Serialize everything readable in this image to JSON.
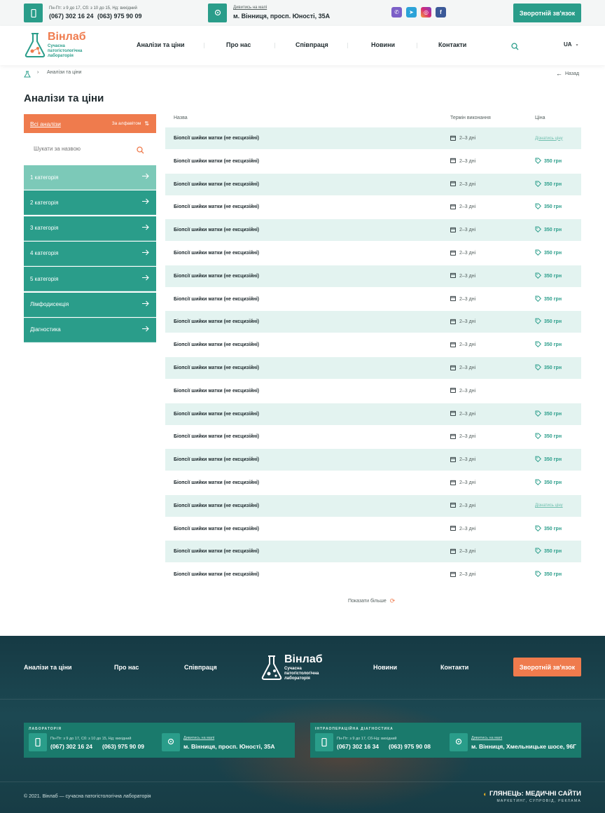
{
  "topbar": {
    "hours": "Пн-Пт: з 9 до 17, Сб: з 10 до 15, Нд: вихідний",
    "phone1": "(067) 302 16 24",
    "phone2": "(063) 975 90 09",
    "map_link": "Дивитись на мапі",
    "address": "м. Вінниця, просп. Юності, 35А",
    "callback_button": "Зворотній зв'язок",
    "social": [
      "viber",
      "telegram",
      "instagram",
      "facebook"
    ]
  },
  "header": {
    "logo_title": "Вінлаб",
    "logo_subtitle": "Сучасна патогістологічна лабораторія",
    "nav": [
      "Аналізи та ціни",
      "Про нас",
      "Співпраця",
      "Новини",
      "Контакти"
    ],
    "lang": "UA"
  },
  "breadcrumbs": {
    "current": "Аналізи та ціни",
    "back": "Назад"
  },
  "page_title": "Аналізи та ціни",
  "sidebar": {
    "all_label": "Всі аналізи",
    "sort_label": "За алфавітом",
    "search_placeholder": "Шукати за назвою",
    "categories": [
      "1 категорія",
      "2 категорія",
      "3 категорія",
      "4 категорія",
      "5 категорія",
      "Лімфодисекція",
      "Діагностика"
    ]
  },
  "table": {
    "headers": {
      "name": "Назва",
      "term": "Термін виконання",
      "price": "Ціна"
    },
    "rows": [
      {
        "name": "Біопсії шийки матки (не ексцизійні)",
        "term": "2–3 дні",
        "price": "Дізнатись ціну",
        "type": "link"
      },
      {
        "name": "Біопсії шийки матки (не ексцизійні)",
        "term": "2–3 дні",
        "price": "350 грн",
        "type": "price"
      },
      {
        "name": "Біопсії шийки матки (не ексцизійні)",
        "term": "2–3 дні",
        "price": "350 грн",
        "type": "price"
      },
      {
        "name": "Біопсії шийки матки (не ексцизійні)",
        "term": "2–3 дні",
        "price": "350 грн",
        "type": "price"
      },
      {
        "name": "Біопсії шийки матки (не ексцизійні)",
        "term": "2–3 дні",
        "price": "350 грн",
        "type": "price"
      },
      {
        "name": "Біопсії шийки матки (не ексцизійні)",
        "term": "2–3 дні",
        "price": "350 грн",
        "type": "price"
      },
      {
        "name": "Біопсії шийки матки (не ексцизійні)",
        "term": "2–3 дні",
        "price": "350 грн",
        "type": "price"
      },
      {
        "name": "Біопсії шийки матки (не ексцизійні)",
        "term": "2–3 дні",
        "price": "350 грн",
        "type": "price"
      },
      {
        "name": "Біопсії шийки матки (не ексцизійні)",
        "term": "2–3 дні",
        "price": "350 грн",
        "type": "price"
      },
      {
        "name": "Біопсії шийки матки (не ексцизійні)",
        "term": "2–3 дні",
        "price": "350 грн",
        "type": "price"
      },
      {
        "name": "Біопсії шийки матки (не ексцизійні)",
        "term": "2–3 дні",
        "price": "350 грн",
        "type": "price"
      },
      {
        "name": "Біопсії шийки матки (не ексцизійні)",
        "term": "2–3 дні",
        "price": "",
        "type": "none"
      },
      {
        "name": "Біопсії шийки матки (не ексцизійні)",
        "term": "2–3 дні",
        "price": "350 грн",
        "type": "price"
      },
      {
        "name": "Біопсії шийки матки (не ексцизійні)",
        "term": "2–3 дні",
        "price": "350 грн",
        "type": "price"
      },
      {
        "name": "Біопсії шийки матки (не ексцизійні)",
        "term": "2–3 дні",
        "price": "350 грн",
        "type": "price"
      },
      {
        "name": "Біопсії шийки матки (не ексцизійні)",
        "term": "2–3 дні",
        "price": "350 грн",
        "type": "price"
      },
      {
        "name": "Біопсії шийки матки (не ексцизійні)",
        "term": "2–3 дні",
        "price": "Дізнатись ціну",
        "type": "link"
      },
      {
        "name": "Біопсії шийки матки (не ексцизійні)",
        "term": "2–3 дні",
        "price": "350 грн",
        "type": "price"
      },
      {
        "name": "Біопсії шийки матки (не ексцизійні)",
        "term": "2–3 дні",
        "price": "350 грн",
        "type": "price"
      },
      {
        "name": "Біопсії шийки матки (не ексцизійні)",
        "term": "2–3 дні",
        "price": "350 грн",
        "type": "price"
      }
    ],
    "show_more": "Показати більше"
  },
  "footer": {
    "nav_left": [
      "Аналізи та ціни",
      "Про нас",
      "Співпраця"
    ],
    "nav_right": [
      "Новини",
      "Контакти"
    ],
    "logo_title": "Вінлаб",
    "logo_subtitle": "Сучасна патогістологічна лабораторія",
    "callback_button": "Зворотній зв'язок",
    "lab": {
      "label": "ЛАБОРАТОРІЯ",
      "hours": "Пн-Пт: з 9 до 17, Сб: з 10 до 15, Нд: вихідний",
      "phone1": "(067) 302 16 24",
      "phone2": "(063) 975 90 09",
      "map_link": "Дивитись на мапі",
      "address": "м. Вінниця, просп. Юності, 35А"
    },
    "intra": {
      "label": "ІНТРАОПЕРАЦІЙНА ДІАГНОСТИКА",
      "hours": "Пн-Пт: з 9 до 17, Сб-Нд: вихідний",
      "phone1": "(067) 302 16 34",
      "phone2": "(063) 975 90 08",
      "map_link": "Дивитись на мапі",
      "address": "м. Вінниця, Хмельницьке шосе, 96Г"
    },
    "copyright": "© 2021. Вінлаб — сучасна патогістологічна лабораторія",
    "dev_brand": "ГЛЯНЕЦЬ: МЕДИЧНІ САЙТИ",
    "dev_tagline": "МАРКЕТИНГ, СУПРОВІД, РЕКЛАМА"
  },
  "colors": {
    "teal": "#2a9d8a",
    "teal_light": "#7cc9b8",
    "orange": "#ef7b4d",
    "row_alt": "#e3f3f0",
    "footer_bg": "#1c4852"
  }
}
